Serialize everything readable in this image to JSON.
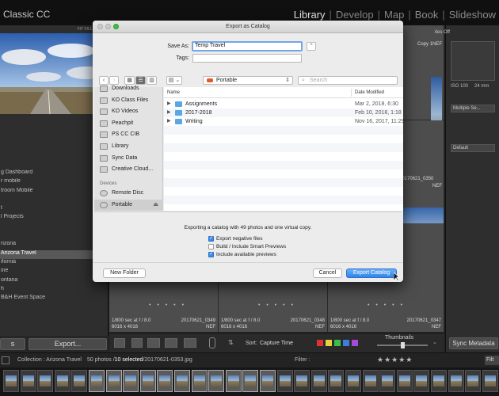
{
  "app": {
    "title": "Classic CC"
  },
  "modules": [
    {
      "label": "Library",
      "active": true
    },
    {
      "label": "Develop",
      "active": false
    },
    {
      "label": "Map",
      "active": false
    },
    {
      "label": "Book",
      "active": false
    },
    {
      "label": "Slideshow",
      "active": false
    }
  ],
  "left_panel": {
    "nav_zoom": "FIT  FILL  1:1  3:1",
    "collections": [
      {
        "label": "g Dashboard",
        "selected": false
      },
      {
        "label": "r mobile",
        "selected": false
      },
      {
        "label": "troom Mobile",
        "selected": false
      },
      {
        "label": "",
        "selected": false
      },
      {
        "label": "t",
        "selected": false
      },
      {
        "label": "l Projects",
        "selected": false
      },
      {
        "label": "",
        "selected": false
      },
      {
        "label": "",
        "selected": false
      },
      {
        "label": "rizona",
        "selected": false
      },
      {
        "label": "Arizona Travel",
        "selected": true
      },
      {
        "label": "ifornia",
        "selected": false
      },
      {
        "label": "ine",
        "selected": false
      },
      {
        "label": "ontana",
        "selected": false
      },
      {
        "label": "h",
        "selected": false
      },
      {
        "label": "B&H Event Space",
        "selected": false
      }
    ],
    "import_label": "s",
    "export_label": "Export..."
  },
  "right_panel": {
    "copy_label": "Copy 1",
    "iso": "ISO 100",
    "focal": "24 mm",
    "multiple": "Multiple Se...",
    "default": "Default",
    "sync_metadata": "Sync Metadata",
    "files_off": "ites Off"
  },
  "grid": {
    "cells": [
      {
        "exposure": "1/800 sec at f / 8.0",
        "name": "20170621_0349",
        "dims": "6016 x 4016",
        "type": "NEF"
      },
      {
        "exposure": "1/800 sec at f / 8.0",
        "name": "20170621_0348",
        "dims": "6016 x 4016",
        "type": "NEF"
      },
      {
        "exposure": "1/800 sec at f / 8.0",
        "name": "20170621_0347",
        "dims": "6016 x 4016",
        "type": "NEF"
      }
    ],
    "right_cell_top": {
      "name": "20170621_0350",
      "type": "NEF"
    },
    "top_right_type": "NEF"
  },
  "toolbar": {
    "sort_label": "Sort:",
    "sort_value": "Capture Time",
    "thumbnails_label": "Thumbnails"
  },
  "filmstrip": {
    "collection": "Collection : Arizona Travel",
    "count_pre": "50 photos /",
    "count_selected": "10 selected",
    "file": "/20170621-0353.jpg",
    "filter_label": "Filter :",
    "filter_btn": "Filt"
  },
  "dialog": {
    "title": "Export as Catalog",
    "save_as_label": "Save As:",
    "save_as_value": "Temp Travel",
    "tags_label": "Tags:",
    "tags_value": "",
    "location": "Portable",
    "search_placeholder": "Search",
    "sidebar": [
      {
        "label": "Downloads",
        "type": "item"
      },
      {
        "label": "KO Class Files",
        "type": "item"
      },
      {
        "label": "KO Videos",
        "type": "item"
      },
      {
        "label": "Peachpit",
        "type": "item"
      },
      {
        "label": "PS CC CIB",
        "type": "item"
      },
      {
        "label": "Library",
        "type": "item"
      },
      {
        "label": "Sync Data",
        "type": "item"
      },
      {
        "label": "Creative Cloud...",
        "type": "item"
      }
    ],
    "devices_header": "Devices",
    "devices": [
      {
        "label": "Remote Disc",
        "selected": false
      },
      {
        "label": "Portable",
        "selected": true
      }
    ],
    "columns": {
      "name": "Name",
      "date": "Date Modified"
    },
    "files": [
      {
        "name": "Assignments",
        "date": "Mar 2, 2018, 6:30"
      },
      {
        "name": "2017-2018",
        "date": "Feb 10, 2018, 1:18"
      },
      {
        "name": "Writing",
        "date": "Nov 16, 2017, 11:29"
      }
    ],
    "summary": "Exporting a catalog with 49 photos and one virtual copy.",
    "options": [
      {
        "label": "Export negative files",
        "checked": true
      },
      {
        "label": "Build / Include Smart Previews",
        "checked": false
      },
      {
        "label": "Include available previews",
        "checked": true
      }
    ],
    "new_folder": "New Folder",
    "cancel": "Cancel",
    "export": "Export Catalog"
  },
  "colors": {
    "accent": "#3f8bea",
    "selected_row": "#585858"
  }
}
